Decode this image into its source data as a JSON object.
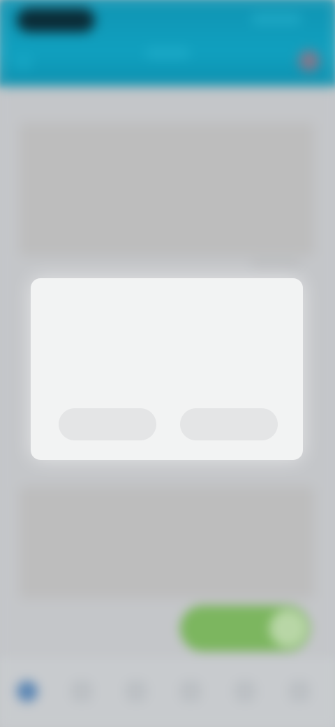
{
  "dialog": {
    "title": "",
    "body": "",
    "secondary_label": "",
    "primary_label": ""
  },
  "bottom_nav": {
    "items": [
      {
        "icon": "home-icon",
        "active": true
      },
      {
        "icon": "search-icon",
        "active": false
      },
      {
        "icon": "list-icon",
        "active": false
      },
      {
        "icon": "calendar-icon",
        "active": false
      },
      {
        "icon": "chat-icon",
        "active": false
      },
      {
        "icon": "menu-icon",
        "active": false
      }
    ]
  },
  "colors": {
    "app_bar": "#0f94b3",
    "accent_green": "#7cb65f",
    "nav_active": "#5b86b4",
    "dialog_bg": "#f2f3f3"
  }
}
